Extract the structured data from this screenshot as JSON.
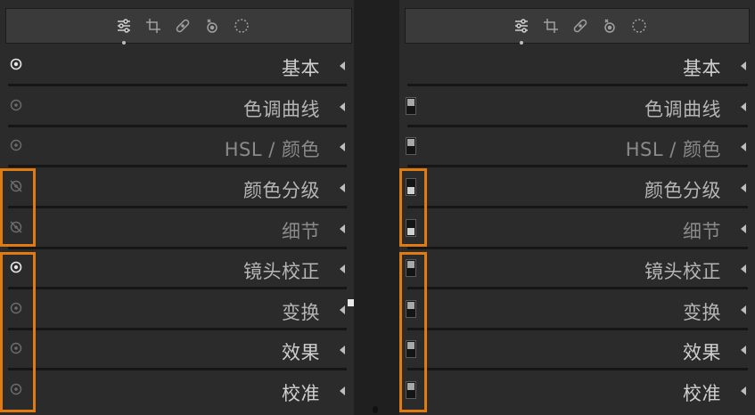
{
  "accent_color": "#e07b12",
  "toolbar_icons": [
    "sliders-icon",
    "crop-icon",
    "bandage-icon",
    "redeye-icon",
    "mask-circle-icon"
  ],
  "left_panel": {
    "rows": [
      {
        "label": "基本",
        "eye": "on"
      },
      {
        "label": "色调曲线",
        "eye": "dim"
      },
      {
        "label": "HSL / 颜色",
        "eye": "dim"
      },
      {
        "label": "颜色分级",
        "eye": "hidden"
      },
      {
        "label": "细节",
        "eye": "hidden"
      },
      {
        "label": "镜头校正",
        "eye": "on"
      },
      {
        "label": "变换",
        "eye": "dim"
      },
      {
        "label": "效果",
        "eye": "dim"
      },
      {
        "label": "校准",
        "eye": "dim"
      }
    ]
  },
  "right_panel": {
    "rows": [
      {
        "label": "基本",
        "switch": "none"
      },
      {
        "label": "色调曲线",
        "switch": "off"
      },
      {
        "label": "HSL / 颜色",
        "switch": "off"
      },
      {
        "label": "颜色分级",
        "switch": "off"
      },
      {
        "label": "细节",
        "switch": "off"
      },
      {
        "label": "镜头校正",
        "switch": "off"
      },
      {
        "label": "变换",
        "switch": "off"
      },
      {
        "label": "效果",
        "switch": "off"
      },
      {
        "label": "校准",
        "switch": "off"
      }
    ]
  }
}
